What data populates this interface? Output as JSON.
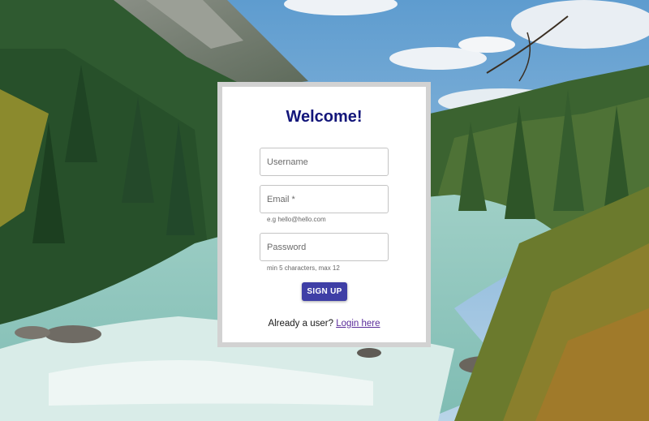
{
  "page": {
    "title": "Welcome!"
  },
  "form": {
    "username": {
      "placeholder": "Username",
      "value": ""
    },
    "email": {
      "placeholder": "Email *",
      "value": "",
      "helper": "e.g hello@hello.com"
    },
    "password": {
      "placeholder": "Password",
      "value": "",
      "helper": "min 5 characters, max 12"
    },
    "signup_label": "SIGN UP"
  },
  "footer": {
    "prompt": "Already a user?",
    "login_link": "Login here"
  },
  "colors": {
    "title": "#13167a",
    "button": "#3f3fa6",
    "link": "#5a2c9a",
    "card_frame": "#d2d2d2"
  }
}
